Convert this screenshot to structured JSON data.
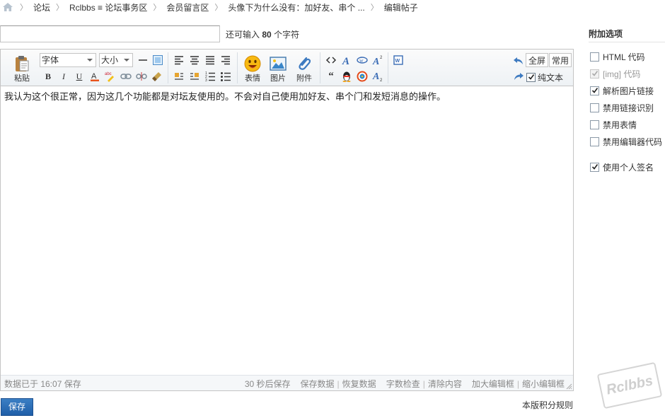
{
  "breadcrumb": {
    "items": [
      "论坛",
      "Rclbbs ≡ 论坛事务区",
      "会员留言区",
      "头像下为什么没有：加好友、串个 ...",
      "编辑帖子"
    ]
  },
  "title": {
    "value": "",
    "hint_prefix": "还可输入",
    "hint_count": "80",
    "hint_suffix": "个字符"
  },
  "toolbar": {
    "paste_label": "粘贴",
    "font_select": "字体",
    "size_select": "大小",
    "emoticon_label": "表情",
    "image_label": "图片",
    "attachment_label": "附件",
    "fullscreen_label": "全屏",
    "common_label": "常用",
    "plain_text_label": "纯文本",
    "plain_text_checked": true
  },
  "content": {
    "text": "我认为这个很正常，因为这几个功能都是对坛友使用的。不会对自己使用加好友、串个门和发短消息的操作。"
  },
  "statusbar": {
    "saved_text": "数据已于 16:07 保存",
    "autosave_text": "30 秒后保存",
    "save_data": "保存数据",
    "restore_data": "恢复数据",
    "word_check": "字数检查",
    "clear_content": "清除内容",
    "enlarge_editor": "加大编辑框",
    "shrink_editor": "缩小编辑框"
  },
  "actions": {
    "save_label": "保存",
    "rules_label": "本版积分规则"
  },
  "sidebar": {
    "heading": "附加选项",
    "options": [
      {
        "label": "HTML 代码",
        "checked": false,
        "disabled": false
      },
      {
        "label": "[img] 代码",
        "checked": true,
        "disabled": true
      },
      {
        "label": "解析图片链接",
        "checked": true,
        "disabled": false
      },
      {
        "label": "禁用链接识别",
        "checked": false,
        "disabled": false
      },
      {
        "label": "禁用表情",
        "checked": false,
        "disabled": false
      },
      {
        "label": "禁用编辑器代码",
        "checked": false,
        "disabled": false
      }
    ],
    "signature": {
      "label": "使用个人签名",
      "checked": true
    }
  },
  "watermark": "Rclbbs",
  "colors": {
    "save_button": "#2a6bb5",
    "border": "#c4c4c4",
    "status_text": "#888888"
  }
}
